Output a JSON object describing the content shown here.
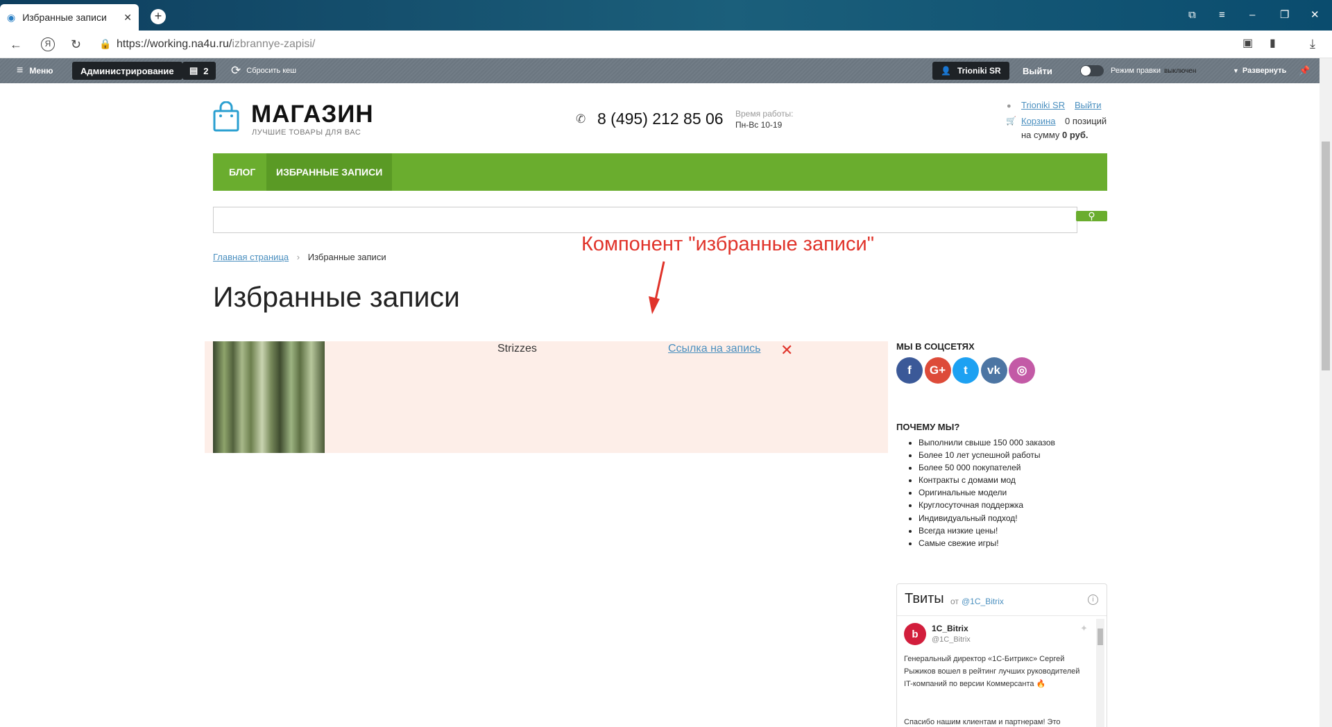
{
  "browser": {
    "tab_title": "Избранные записи",
    "url_host": "https://working.na4u.ru/",
    "url_path": "izbrannye-zapisi/"
  },
  "admin": {
    "menu_label": "Меню",
    "administration_label": "Администрирование",
    "notifications_count": "2",
    "reset_cache_label": "Сбросить кеш",
    "user_label": "Trioniki SR",
    "logout_label": "Выйти",
    "edit_mode_label": "Режим правки",
    "edit_mode_state": "выключен",
    "expand_label": "Развернуть"
  },
  "header": {
    "logo_title": "МАГАЗИН",
    "logo_subtitle": "ЛУЧШИЕ ТОВАРЫ ДЛЯ ВАС",
    "phone": "8 (495) 212 85 06",
    "hours_label": "Время работы:",
    "hours_value": "Пн-Вс 10-19",
    "user_name": "Trioniki SR",
    "logout": "Выйти",
    "cart_link": "Корзина",
    "cart_positions": "0 позиций",
    "cart_sum_prefix": "на сумму",
    "cart_sum_value": "0 руб."
  },
  "nav": {
    "items": [
      {
        "label": "БЛОГ"
      },
      {
        "label": "ИЗБРАННЫЕ ЗАПИСИ"
      }
    ]
  },
  "breadcrumb": {
    "home": "Главная страница",
    "current": "Избранные записи"
  },
  "annotation": "Компонент \"избранные записи\"",
  "page_title": "Избранные записи",
  "favorites": [
    {
      "name": "Strizzes",
      "link_label": "Ссылка на запись"
    }
  ],
  "sidebar": {
    "social_heading": "МЫ В СОЦСЕТЯХ",
    "social": [
      {
        "icon": "facebook-icon",
        "glyph": "f",
        "color": "#3b5998"
      },
      {
        "icon": "google-plus-icon",
        "glyph": "G+",
        "color": "#dd4b39"
      },
      {
        "icon": "twitter-icon",
        "glyph": "t",
        "color": "#1da1f2"
      },
      {
        "icon": "vk-icon",
        "glyph": "vk",
        "color": "#4c75a3"
      },
      {
        "icon": "instagram-icon",
        "glyph": "◎",
        "color": "#c35aa6"
      }
    ],
    "why_heading": "ПОЧЕМУ МЫ?",
    "why_items": [
      "Выполнили свыше 150 000 заказов",
      "Более 10 лет успешной работы",
      "Более 50 000 покупателей",
      "Контракты с домами мод",
      "Оригинальные модели",
      "Круглосуточная поддержка",
      "Индивидуальный подход!",
      "Всегда низкие цены!",
      "Самые свежие игры!"
    ]
  },
  "tweets": {
    "title": "Твиты",
    "from_label": "от",
    "handle": "@1C_Bitrix",
    "author_name": "1C_Bitrix",
    "author_handle": "@1C_Bitrix",
    "text": "Генеральный директор «1С-Битрикс» Сергей Рыжиков вошел в рейтинг лучших руководителей IT-компаний по версии Коммерсанта 🔥",
    "text2": "Спасибо нашим клиентам и партнерам! Это"
  }
}
